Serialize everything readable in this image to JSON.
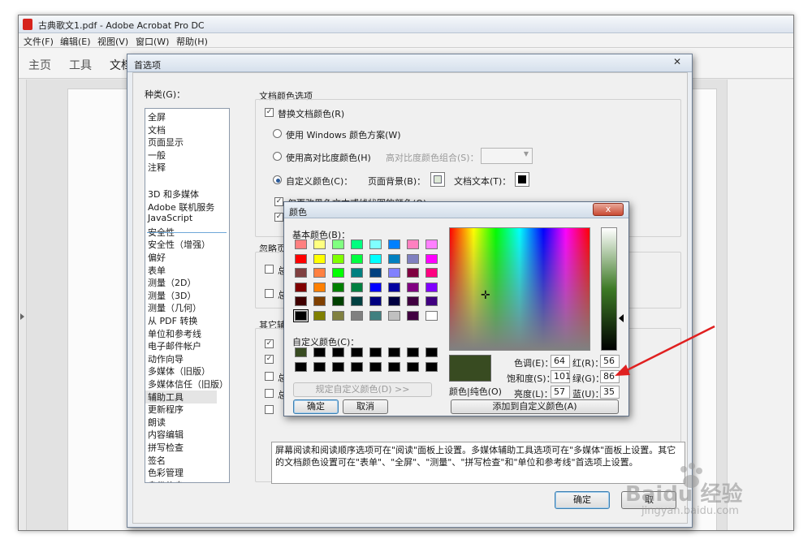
{
  "app": {
    "title": "古典歌文1.pdf - Adobe Acrobat Pro DC",
    "menu": [
      "文件(F)",
      "编辑(E)",
      "视图(V)",
      "窗口(W)",
      "帮助(H)"
    ],
    "tabs": [
      "主页",
      "工具",
      "文档"
    ]
  },
  "prefs": {
    "title": "首选项",
    "category_label": "种类(G)：",
    "categories_top": [
      "全屏",
      "文档",
      "页面显示",
      "一般",
      "注释"
    ],
    "categories": [
      "3D 和多媒体",
      "Adobe 联机服务",
      "JavaScript",
      "安全性",
      "安全性（增强）",
      "偏好",
      "表单",
      "测量（2D）",
      "测量（3D）",
      "测量（几何）",
      "从 PDF 转换",
      "单位和参考线",
      "电子邮件帐户",
      "动作向导",
      "多媒体（旧版）",
      "多媒体信任（旧版）",
      "辅助工具",
      "更新程序",
      "朗读",
      "内容编辑",
      "拼写检查",
      "签名",
      "色彩管理",
      "身份信息"
    ],
    "selected_category": "辅助工具",
    "doc_color_section": "文档颜色选项",
    "replace_doc_colors": "替换文档颜色(R)",
    "use_windows_scheme": "使用 Windows 颜色方案(W)",
    "use_high_contrast": "使用高对比度颜色(H)",
    "high_contrast_combo_label": "高对比度颜色组合(S)：",
    "custom_color": "自定义颜色(C)：",
    "page_background": "页面背景(B)：",
    "doc_text": "文档文本(T)：",
    "only_change_text": "仅更改黑色文本或线状图的颜色(O)",
    "ignore_section": "忽略页",
    "other_section": "其它辅",
    "always_prefix": "总",
    "description": "屏幕阅读和阅读顺序选项可在\"阅读\"面板上设置。多媒体辅助工具选项可在\"多媒体\"面板上设置。其它的文档颜色设置可在\"表单\"、\"全屏\"、\"测量\"、\"拼写检查\"和\"单位和参考线\"首选项上设置。",
    "ok": "确定",
    "cancel_partial": "取"
  },
  "color_dialog": {
    "title": "颜色",
    "basic_colors_label": "基本颜色(B)：",
    "custom_colors_label": "自定义颜色(C)：",
    "define_custom": "规定自定义颜色(D) >>",
    "ok": "确定",
    "cancel": "取消",
    "color_solid_label": "颜色|纯色(O)",
    "hue_label": "色调(E)：",
    "hue": "64",
    "sat_label": "饱和度(S)：",
    "sat": "101",
    "lum_label": "亮度(L)：",
    "lum": "57",
    "red_label": "红(R)：",
    "red": "56",
    "green_label": "绿(G)：",
    "green": "86",
    "blue_label": "蓝(U)：",
    "blue": "35",
    "add_custom": "添加到自定义颜色(A)",
    "close_symbol": "x",
    "basic_colors": [
      "#ff8080",
      "#ffff80",
      "#80ff80",
      "#00ff80",
      "#80ffff",
      "#0080ff",
      "#ff80c0",
      "#ff80ff",
      "#ff0000",
      "#ffff00",
      "#80ff00",
      "#00ff40",
      "#00ffff",
      "#0080c0",
      "#8080c0",
      "#ff00ff",
      "#804040",
      "#ff8040",
      "#00ff00",
      "#008080",
      "#004080",
      "#8080ff",
      "#800040",
      "#ff0080",
      "#800000",
      "#ff8000",
      "#008000",
      "#008040",
      "#0000ff",
      "#0000a0",
      "#800080",
      "#8000ff",
      "#400000",
      "#804000",
      "#004000",
      "#004040",
      "#000080",
      "#000040",
      "#400040",
      "#400080",
      "#000000",
      "#808000",
      "#808040",
      "#808080",
      "#408080",
      "#c0c0c0",
      "#400040",
      "#ffffff"
    ],
    "custom_colors": [
      "#384b21",
      "#000000",
      "#000000",
      "#000000",
      "#000000",
      "#000000",
      "#000000",
      "#000000",
      "#000000",
      "#000000",
      "#000000",
      "#000000",
      "#000000",
      "#000000",
      "#000000",
      "#000000"
    ],
    "preview_color": "#384b21"
  },
  "watermark": {
    "brand": "Baidu 经验",
    "url": "jingyan.baidu.com"
  },
  "colors": {
    "annotation_arrow": "#e02020",
    "selection": "#e5e5e5"
  }
}
